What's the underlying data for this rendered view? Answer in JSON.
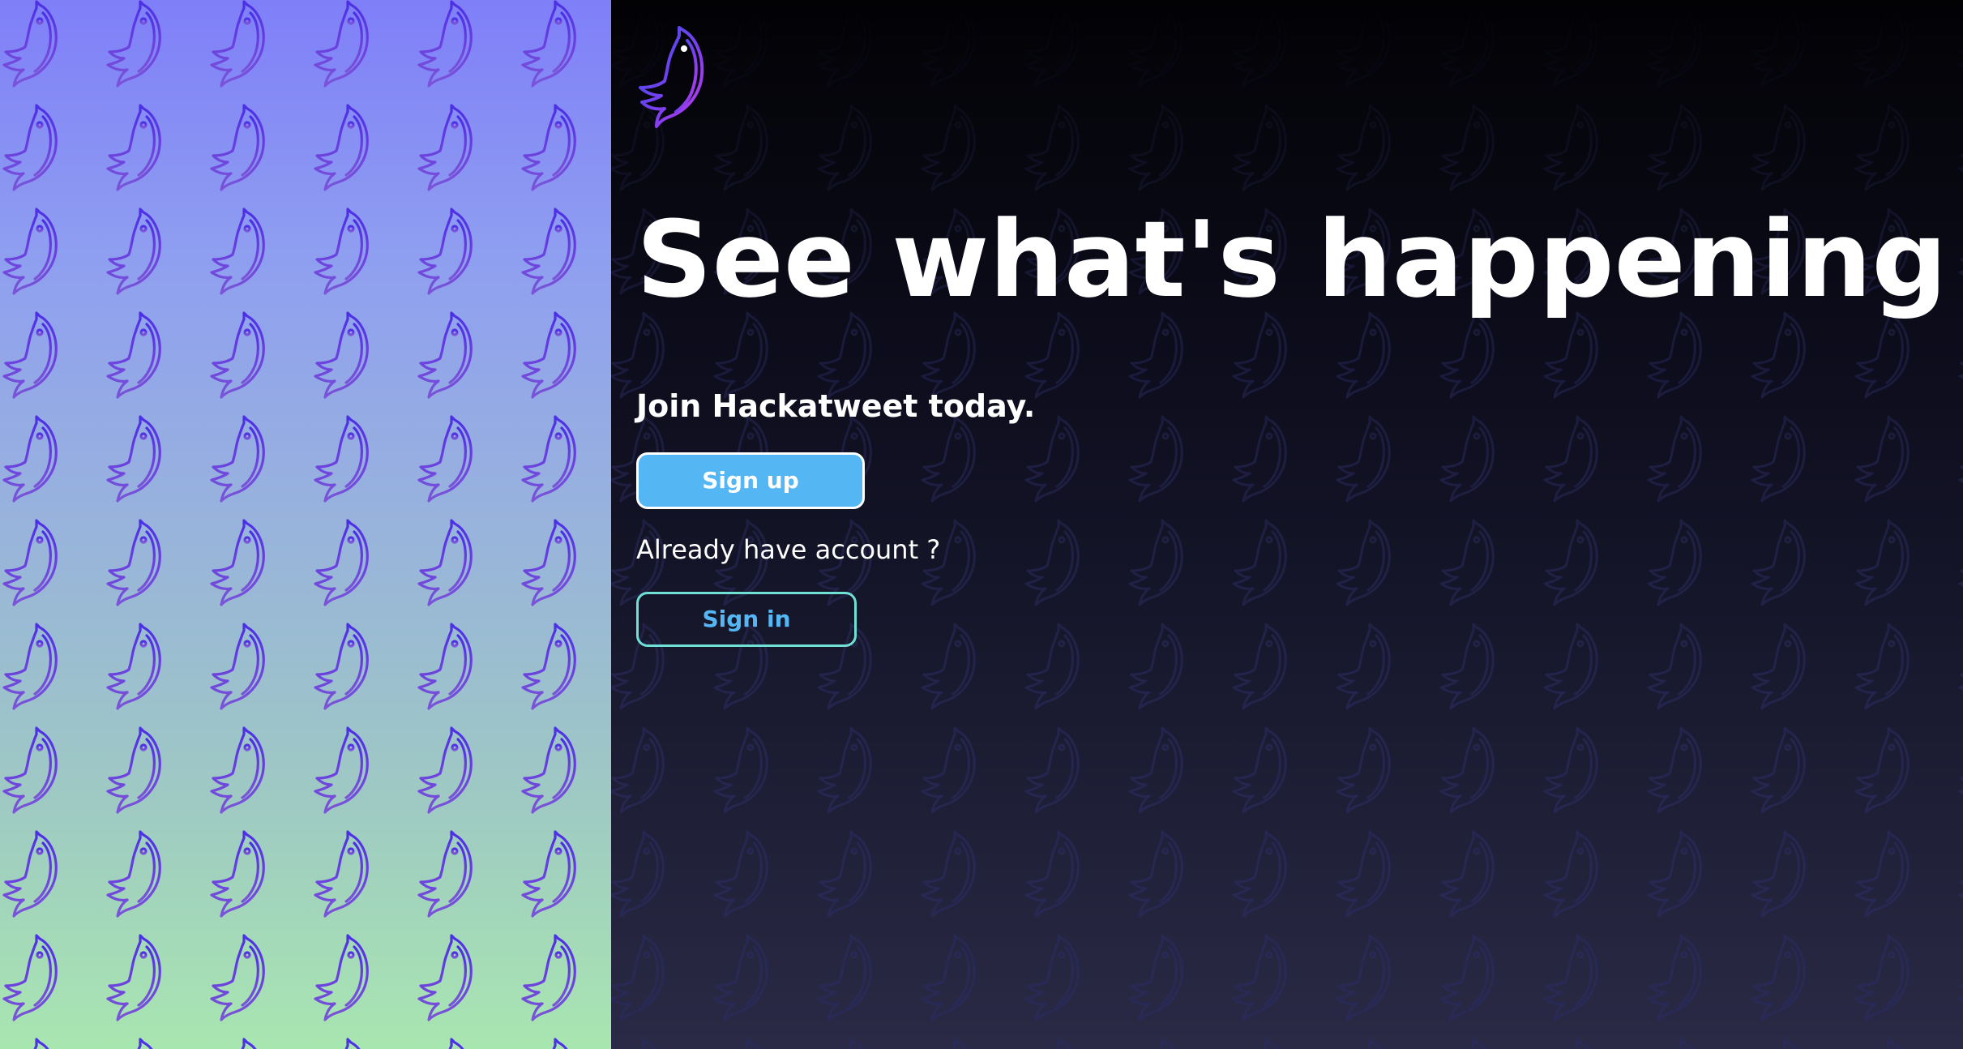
{
  "app": {
    "name": "Hackatweet"
  },
  "hero": {
    "title": "See what's happening",
    "subtitle": "Join Hackatweet today."
  },
  "actions": {
    "signup_label": "Sign up",
    "already_text": "Already have account ?",
    "signin_label": "Sign in"
  },
  "icons": {
    "logo": "bird-logo-icon",
    "pattern": "bird-pattern-icon"
  },
  "colors": {
    "left_gradient_top": "#7f7ff8",
    "left_gradient_bottom": "#a8e6b0",
    "right_gradient_top": "#020205",
    "right_gradient_bottom": "#2a2a46",
    "signup_bg": "#55b6f4",
    "signin_border": "#6fe0d4",
    "signin_text": "#55b6f4",
    "bird_stroke_left": "#6a3ff0",
    "bird_stroke_right": "#24245a"
  }
}
